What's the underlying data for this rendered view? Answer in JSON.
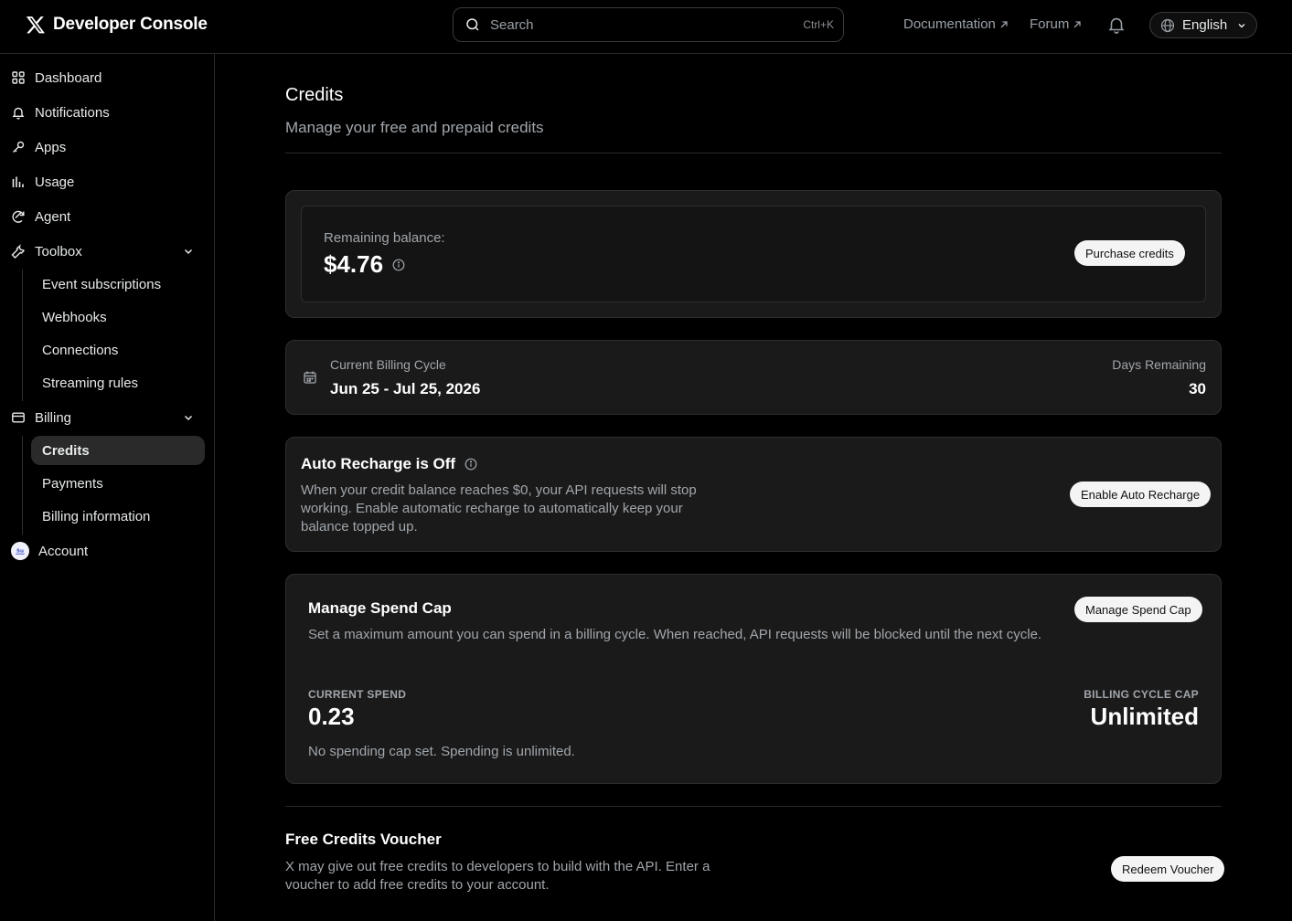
{
  "header": {
    "brand": "Developer Console",
    "search_placeholder": "Search",
    "search_shortcut": "Ctrl+K",
    "links": [
      "Documentation",
      "Forum"
    ],
    "language": "English"
  },
  "sidebar": {
    "items": [
      {
        "label": "Dashboard",
        "icon": "grid-icon"
      },
      {
        "label": "Notifications",
        "icon": "bell-icon"
      },
      {
        "label": "Apps",
        "icon": "key-icon"
      },
      {
        "label": "Usage",
        "icon": "bar-chart-icon"
      },
      {
        "label": "Agent",
        "icon": "agent-icon"
      },
      {
        "label": "Toolbox",
        "icon": "wrench-icon"
      }
    ],
    "toolbox_sub": [
      "Event subscriptions",
      "Webhooks",
      "Connections",
      "Streaming rules"
    ],
    "billing_label": "Billing",
    "billing_sub": [
      "Credits",
      "Payments",
      "Billing information"
    ],
    "active_sub": "Credits",
    "account_label": "Account"
  },
  "page": {
    "title": "Credits",
    "subtitle": "Manage your free and prepaid credits"
  },
  "balance": {
    "label": "Remaining balance:",
    "value": "$4.76",
    "button": "Purchase credits"
  },
  "billing_cycle": {
    "label": "Current Billing Cycle",
    "range": "Jun 25 - Jul 25, 2026",
    "days_label": "Days Remaining",
    "days_value": "30"
  },
  "auto_recharge": {
    "title": "Auto Recharge is Off",
    "description": "When your credit balance reaches $0, your API requests will stop working. Enable automatic recharge to automatically keep your balance topped up.",
    "button": "Enable Auto Recharge"
  },
  "spend_cap": {
    "title": "Manage Spend Cap",
    "description": "Set a maximum amount you can spend in a billing cycle. When reached, API requests will be blocked until the next cycle.",
    "button": "Manage Spend Cap",
    "current_label": "CURRENT SPEND",
    "current_value": "0.23",
    "cap_label": "BILLING CYCLE CAP",
    "cap_value": "Unlimited",
    "note": "No spending cap set. Spending is unlimited."
  },
  "voucher": {
    "title": "Free Credits Voucher",
    "description": "X may give out free credits to developers to build with the API. Enter a voucher to add free credits to your account.",
    "button": "Redeem Voucher"
  }
}
